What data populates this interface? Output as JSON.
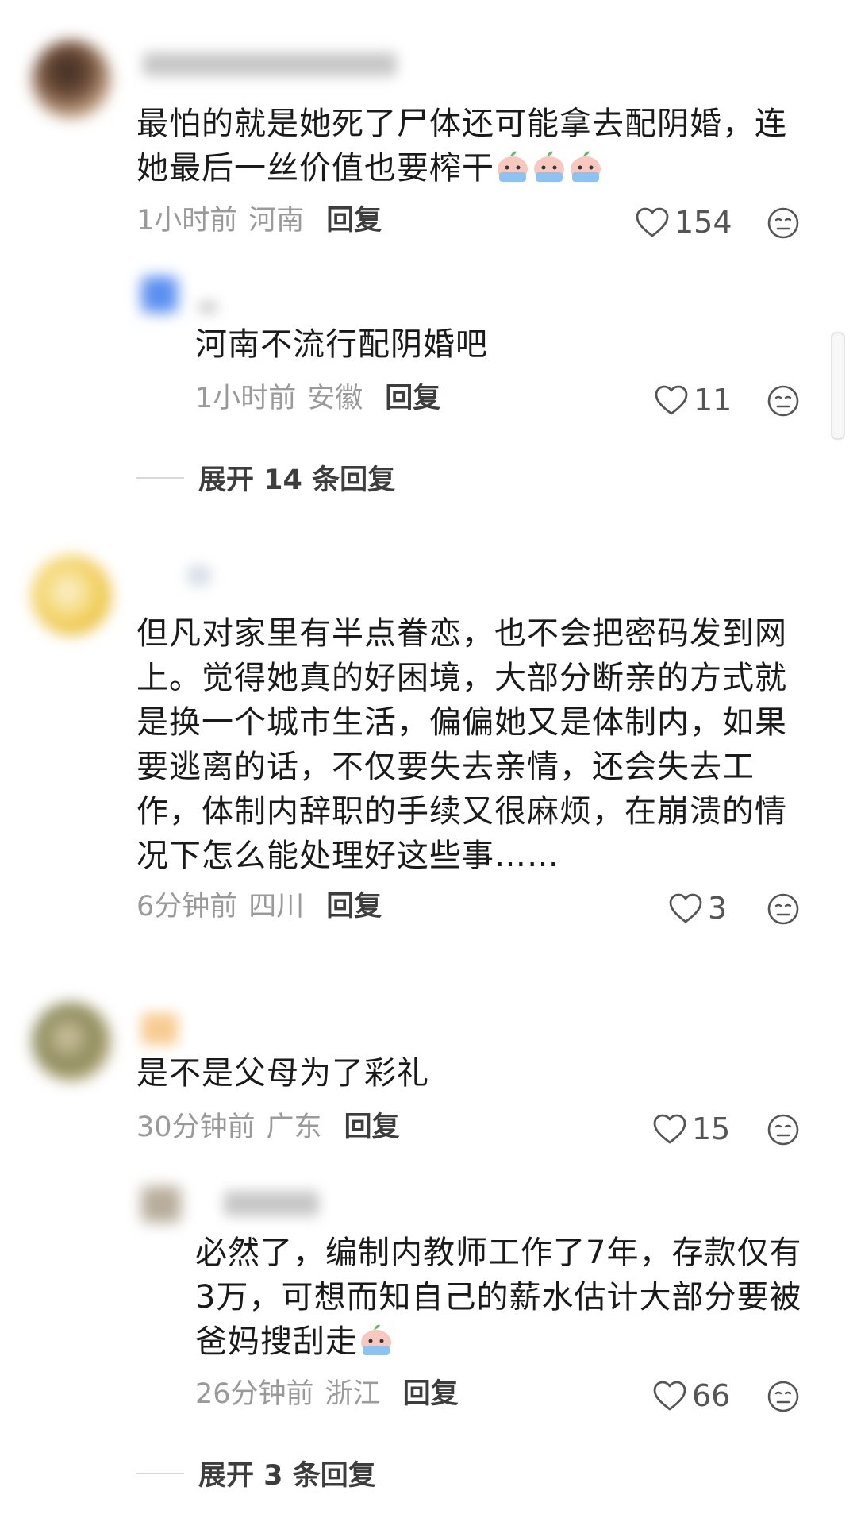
{
  "comments": [
    {
      "text": "最怕的就是她死了尸体还可能拿去配阴婚，连\n她最后一丝价值也要榨干",
      "time": "1小时前",
      "location": "河南",
      "reply_label": "回复",
      "likes": "154",
      "emoji_count": 3
    },
    {
      "text": "河南不流行配阴婚吧",
      "time": "1小时前",
      "location": "安徽",
      "reply_label": "回复",
      "likes": "11"
    },
    {
      "text": "但凡对家里有半点眷恋，也不会把密码发到网\n上。觉得她真的好困境，大部分断亲的方式就\n是换一个城市生活，偏偏她又是体制内，如果\n要逃离的话，不仅要失去亲情，还会失去工\n作，体制内辞职的手续又很麻烦，在崩溃的情\n况下怎么能处理好这些事……",
      "time": "6分钟前",
      "location": "四川",
      "reply_label": "回复",
      "likes": "3"
    },
    {
      "text": "是不是父母为了彩礼",
      "time": "30分钟前",
      "location": "广东",
      "reply_label": "回复",
      "likes": "15"
    },
    {
      "text": "必然了，编制内教师工作了7年，存款仅有\n3万，可想而知自己的薪水估计大部分要被\n爸妈搜刮走",
      "time": "26分钟前",
      "location": "浙江",
      "reply_label": "回复",
      "likes": "66",
      "emoji_count": 1
    }
  ],
  "expand_1": "展开 14 条回复",
  "expand_2": "展开 3 条回复",
  "icons": {
    "like": "heart-outline-icon",
    "dislike": "meh-face-icon",
    "emoji": "crying-peach-emoji"
  },
  "colors": {
    "meta": "#9a9a9a",
    "text": "#1a1a1a",
    "reply": "#3d3d3d"
  }
}
